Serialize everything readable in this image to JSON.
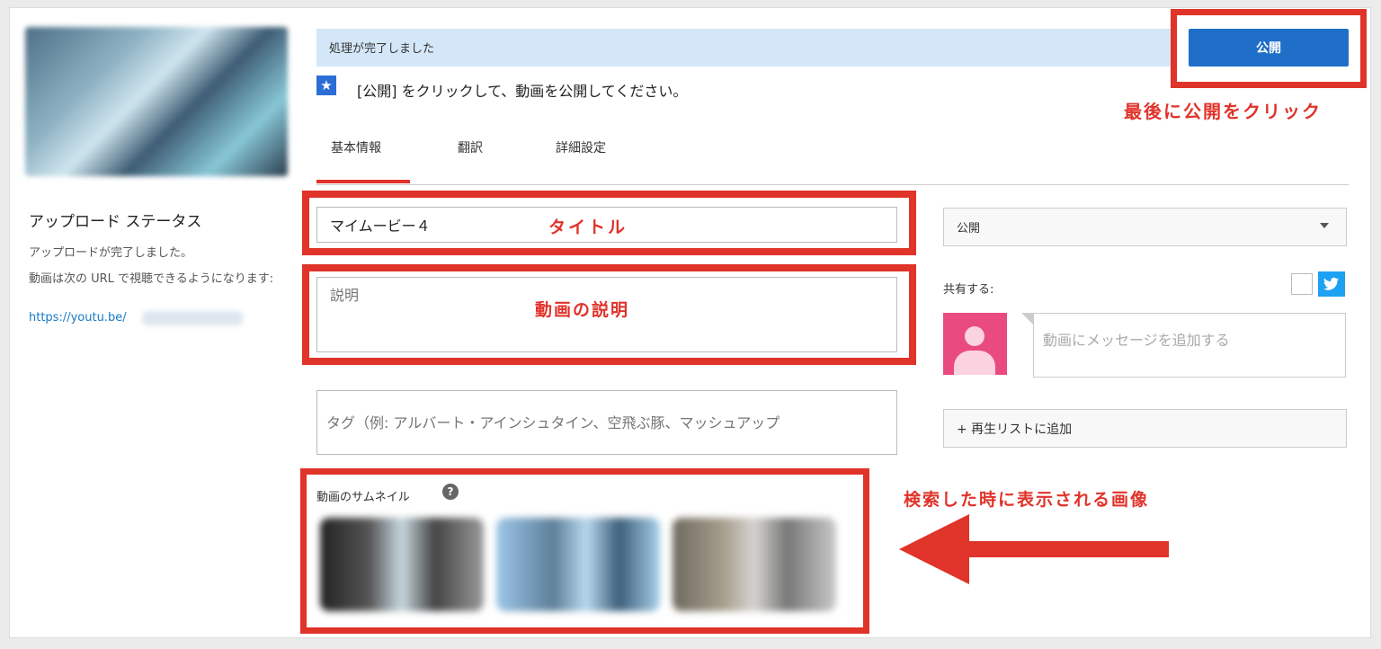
{
  "upload_status": {
    "title": "アップロード ステータス",
    "done": "アップロードが完了しました。",
    "url_text": "動画は次の URL で視聴できるようになります:",
    "url_prefix": "https://youtu.be/"
  },
  "banner": {
    "text": "処理が完了しました",
    "info_text": "[公開] をクリックして、動画を公開してください。"
  },
  "publish_button": "公開",
  "tabs": [
    {
      "label": "基本情報",
      "active": true
    },
    {
      "label": "翻訳",
      "active": false
    },
    {
      "label": "詳細設定",
      "active": false
    }
  ],
  "fields": {
    "title_value": "マイムービー４",
    "description_placeholder": "説明",
    "tags_placeholder": "タグ（例: アルバート・アインシュタイン、空飛ぶ豚、マッシュアップ"
  },
  "thumbnails": {
    "label": "動画のサムネイル",
    "help_glyph": "?"
  },
  "right_panel": {
    "privacy_value": "公開",
    "share_label": "共有する:",
    "message_placeholder": "動画にメッセージを追加する",
    "playlist_button": "+ 再生リストに追加"
  },
  "annotations": {
    "publish": "最後に公開をクリック",
    "title": "タイトル",
    "description": "動画の説明",
    "thumbnail": "検索した時に表示される画像"
  },
  "colors": {
    "annotation_red": "#e0332a",
    "publish_blue": "#1f6fc8",
    "banner_blue": "#d4e7f8",
    "twitter_blue": "#1da1f2",
    "avatar_pink": "#e94b80"
  },
  "icons": [
    "star-icon",
    "help-icon",
    "twitter-icon",
    "avatar-icon",
    "dropdown-caret-icon",
    "arrow-left-icon"
  ]
}
